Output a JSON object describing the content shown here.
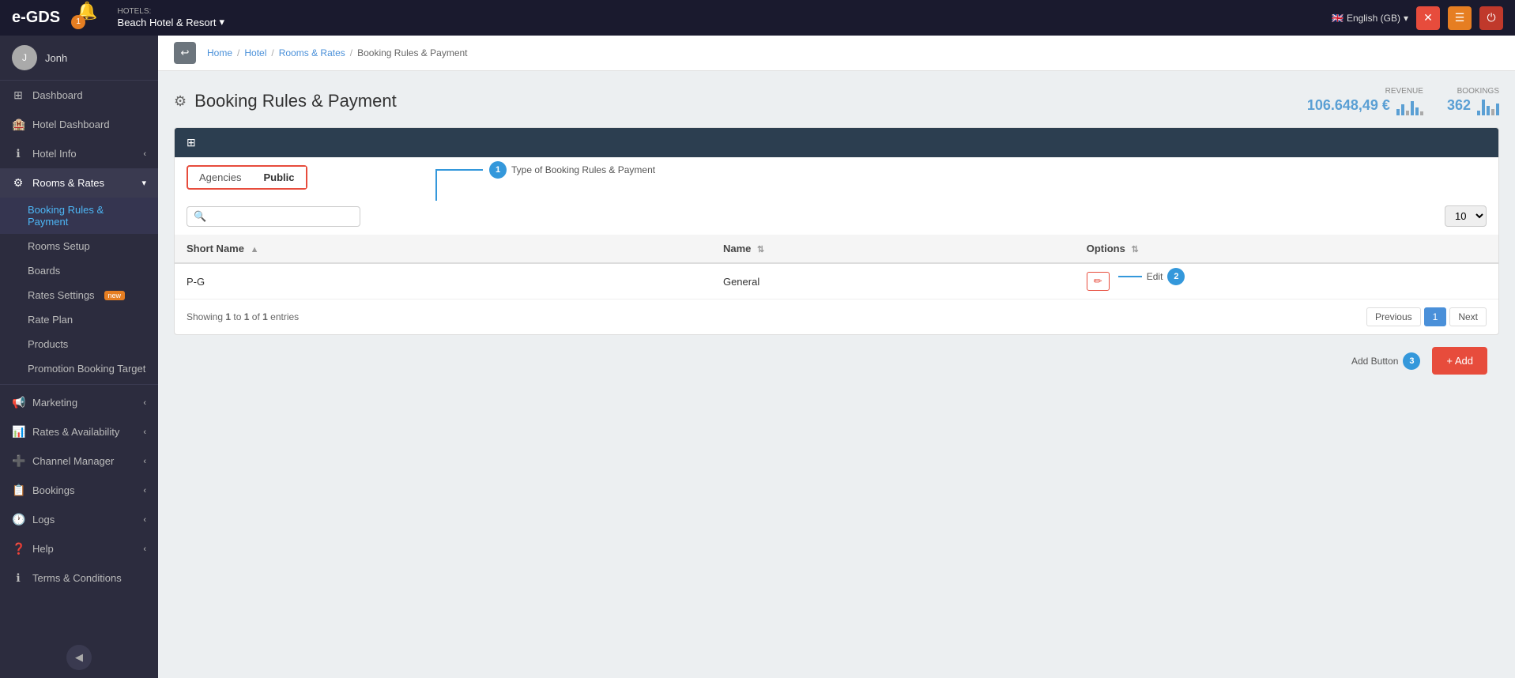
{
  "app": {
    "logo": "e-GDS",
    "hotels_label": "HOTELS:",
    "hotel_name": "Beach Hotel & Resort",
    "language": "English (GB)"
  },
  "topnav": {
    "notification_count": "1",
    "icons": [
      "✕",
      "☰",
      "⏻"
    ]
  },
  "sidebar": {
    "username": "Jonh",
    "nav_items": [
      {
        "id": "dashboard",
        "label": "Dashboard",
        "icon": "⊞"
      },
      {
        "id": "hotel-dashboard",
        "label": "Hotel Dashboard",
        "icon": "🏨"
      },
      {
        "id": "hotel-info",
        "label": "Hotel Info",
        "icon": "ℹ",
        "has_arrow": true
      },
      {
        "id": "rooms-rates",
        "label": "Rooms & Rates",
        "icon": "⚙",
        "has_arrow": true,
        "active": true
      }
    ],
    "sub_items": [
      {
        "id": "booking-rules",
        "label": "Booking Rules & Payment",
        "active": true
      },
      {
        "id": "rooms-setup",
        "label": "Rooms Setup"
      },
      {
        "id": "boards",
        "label": "Boards"
      },
      {
        "id": "rates-settings",
        "label": "Rates Settings",
        "badge": "new"
      },
      {
        "id": "rate-plan",
        "label": "Rate Plan"
      },
      {
        "id": "products",
        "label": "Products"
      },
      {
        "id": "promotion",
        "label": "Promotion Booking Target"
      }
    ],
    "bottom_nav": [
      {
        "id": "marketing",
        "label": "Marketing",
        "icon": "📢",
        "has_arrow": true
      },
      {
        "id": "rates-availability",
        "label": "Rates & Availability",
        "icon": "📊",
        "has_arrow": true
      },
      {
        "id": "channel-manager",
        "label": "Channel Manager",
        "icon": "➕",
        "has_arrow": true
      },
      {
        "id": "bookings",
        "label": "Bookings",
        "icon": "📋",
        "has_arrow": true
      },
      {
        "id": "logs",
        "label": "Logs",
        "icon": "🕐",
        "has_arrow": true
      },
      {
        "id": "help",
        "label": "Help",
        "icon": "❓",
        "has_arrow": true
      },
      {
        "id": "terms",
        "label": "Terms & Conditions",
        "icon": "ℹ"
      }
    ]
  },
  "breadcrumb": {
    "items": [
      "Home",
      "Hotel",
      "Rooms & Rates",
      "Booking Rules & Payment"
    ]
  },
  "page": {
    "title": "Booking Rules & Payment",
    "gear_icon": "⚙",
    "revenue_label": "REVENUE",
    "revenue_value": "106.648,49 €",
    "bookings_label": "BOOKINGS",
    "bookings_value": "362"
  },
  "table": {
    "tabs": [
      {
        "id": "agencies",
        "label": "Agencies"
      },
      {
        "id": "public",
        "label": "Public",
        "active": true
      }
    ],
    "search_placeholder": "",
    "per_page": "10",
    "columns": [
      {
        "id": "short-name",
        "label": "Short Name"
      },
      {
        "id": "name",
        "label": "Name"
      },
      {
        "id": "options",
        "label": "Options"
      }
    ],
    "rows": [
      {
        "short_name": "P-G",
        "name": "General"
      }
    ],
    "showing_text": "Showing",
    "showing_from": "1",
    "showing_to": "1",
    "showing_of": "1",
    "showing_suffix": "entries",
    "pagination": {
      "previous": "Previous",
      "current": "1",
      "next": "Next"
    }
  },
  "actions": {
    "add_button": "+ Add",
    "add_label": "Add Button",
    "callout1_label": "Type of Booking Rules & Payment",
    "callout2_label": "Edit",
    "callout3_label": "Add Button"
  }
}
